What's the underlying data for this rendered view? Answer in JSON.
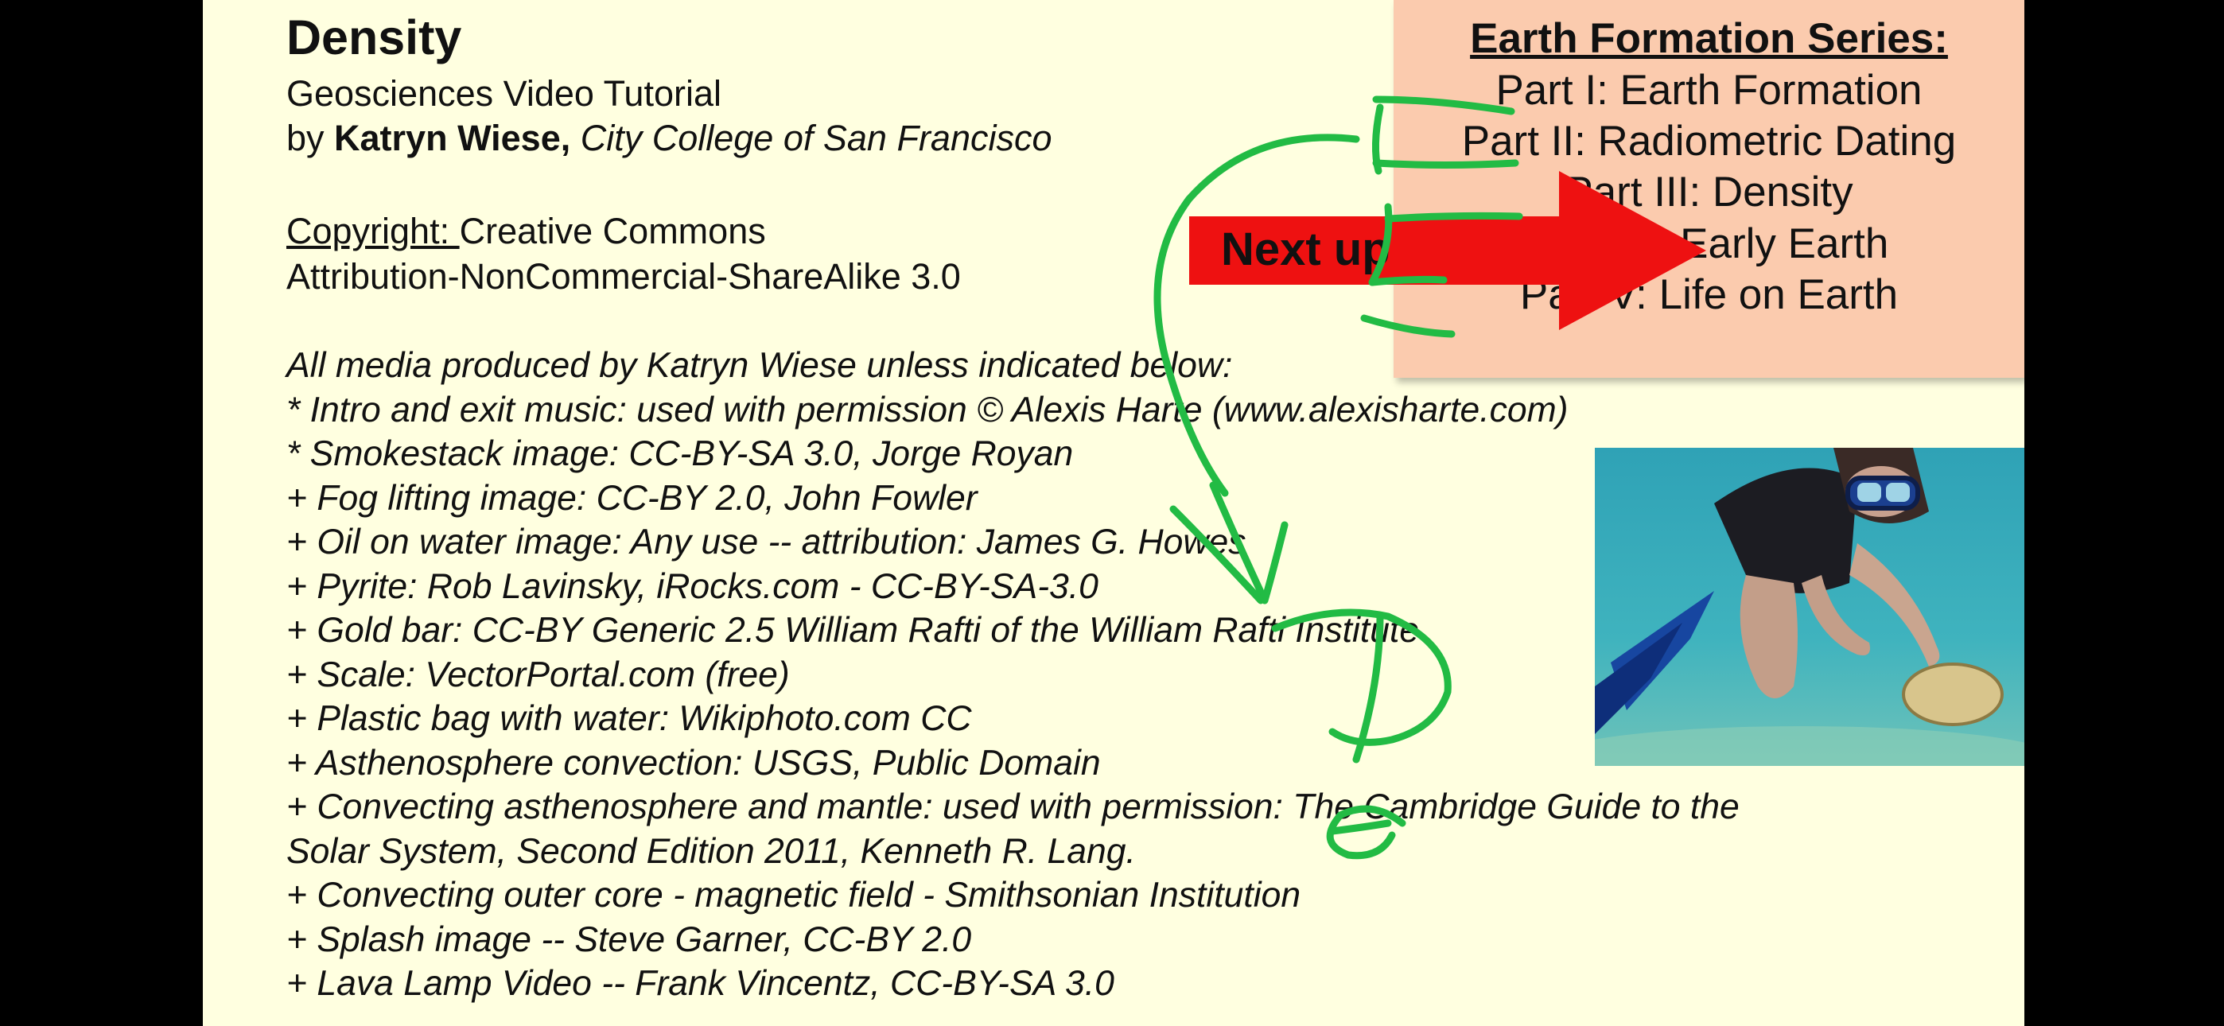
{
  "slide": {
    "title": "Density",
    "subtitle": "Geosciences Video Tutorial",
    "byline": {
      "prefix": "by ",
      "author": "Katryn Wiese,",
      "institution": " City College of San Francisco"
    },
    "copyright": {
      "label": "Copyright: ",
      "value": "Creative Commons"
    },
    "license": "Attribution-NonCommercial-ShareAlike 3.0",
    "credits": [
      "All media produced by Katryn Wiese unless indicated below:",
      "* Intro and exit music: used with permission © Alexis Harte (www.alexisharte.com)",
      "* Smokestack image: CC-BY-SA 3.0, Jorge Royan",
      "+ Fog lifting image: CC-BY 2.0, John Fowler",
      "+ Oil on water image: Any use -- attribution: James G. Howes",
      "+ Pyrite: Rob Lavinsky, iRocks.com - CC-BY-SA-3.0",
      "+ Gold bar: CC-BY Generic 2.5 William Rafti of the William Rafti Institute",
      "+ Scale: VectorPortal.com (free)",
      "+ Plastic bag with water: Wikiphoto.com CC",
      "+ Asthenosphere convection: USGS, Public Domain",
      "+ Convecting asthenosphere and mantle: used with permission: The Cambridge Guide to the",
      "Solar System, Second Edition 2011, Kenneth R. Lang.",
      "+ Convecting outer core - magnetic field - Smithsonian Institution",
      "+ Splash image -- Steve Garner, CC-BY 2.0",
      "+ Lava Lamp Video -- Frank Vincentz, CC-BY-SA 3.0"
    ]
  },
  "series": {
    "heading": "Earth Formation Series:",
    "parts": [
      "Part I: Earth Formation",
      "Part II: Radiometric Dating",
      "Part III: Density",
      "Part IV: Early Earth",
      "Part V: Life on Earth"
    ]
  },
  "next_up_label": "Next up",
  "colors": {
    "slide_bg": "#FFFFE0",
    "series_bg": "#FBCBAE",
    "arrow_red": "#EE1111",
    "ink_green": "#22BB44"
  }
}
